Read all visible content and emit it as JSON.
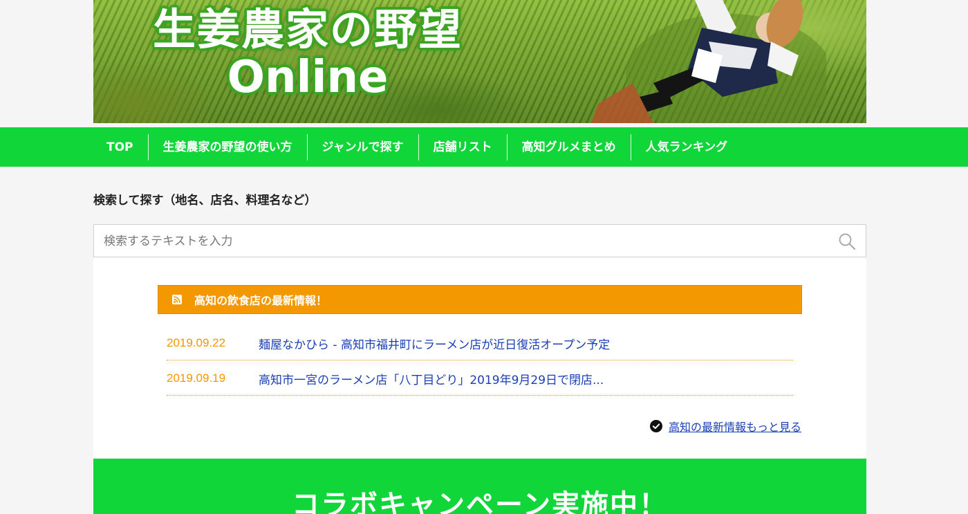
{
  "header": {
    "title_line1": "生姜農家の野望",
    "title_line2": "Online"
  },
  "nav": {
    "items": [
      "TOP",
      "生姜農家の野望の使い方",
      "ジャンルで探す",
      "店舗リスト",
      "高知グルメまとめ",
      "人気ランキング"
    ]
  },
  "search": {
    "heading": "検索して探す（地名、店名、料理名など）",
    "placeholder": "検索するテキストを入力",
    "icon": "search-icon"
  },
  "news": {
    "header": "高知の飲食店の最新情報！",
    "icon": "rss-icon",
    "items": [
      {
        "date": "2019.09.22",
        "title": "麺屋なかひら - 高知市福井町にラーメン店が近日復活オープン予定"
      },
      {
        "date": "2019.09.19",
        "title": "高知市一宮のラーメン店「八丁目どり」2019年9月29日で閉店..."
      }
    ],
    "more": "高知の最新情報もっと見る"
  },
  "campaign": {
    "title": "コラボキャンペーン実施中！"
  },
  "colors": {
    "nav_green": "#10d63a",
    "news_orange": "#f39800",
    "link_blue": "#1a3fb5"
  }
}
